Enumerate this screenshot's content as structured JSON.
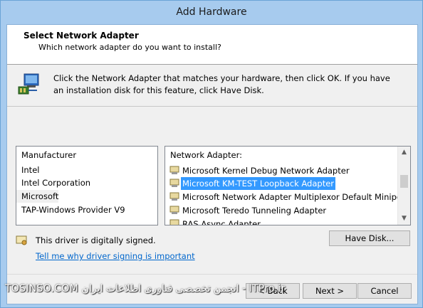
{
  "window": {
    "title": "Add Hardware"
  },
  "header": {
    "title": "Select Network Adapter",
    "subtitle": "Which network adapter do you want to install?"
  },
  "instructions": "Click the Network Adapter that matches your hardware, then click OK. If you have an installation disk for this feature, click Have Disk.",
  "manufacturer_list": {
    "header": "Manufacturer",
    "items": [
      "Intel",
      "Intel Corporation",
      "Microsoft",
      "TAP-Windows Provider V9"
    ],
    "selected": "Microsoft"
  },
  "adapter_list": {
    "header": "Network Adapter:",
    "items": [
      "Microsoft Kernel Debug Network Adapter",
      "Microsoft KM-TEST Loopback Adapter",
      "Microsoft Network Adapter Multiplexor Default Miniport",
      "Microsoft Teredo Tunneling Adapter",
      "RAS Async Adapter"
    ],
    "selected": "Microsoft KM-TEST Loopback Adapter"
  },
  "driver": {
    "signed_text": "This driver is digitally signed.",
    "link_text": "Tell me why driver signing is important"
  },
  "buttons": {
    "have_disk": "Have Disk...",
    "back": "< Back",
    "next": "Next >",
    "cancel": "Cancel"
  },
  "watermark": "TOSINSO.COM انجمن تخصصی فناوری اطلاعات ایران - ITPro.ir",
  "colors": {
    "selection": "#3399ff",
    "link": "#0066cc",
    "titlebar": "#a7cbee"
  }
}
